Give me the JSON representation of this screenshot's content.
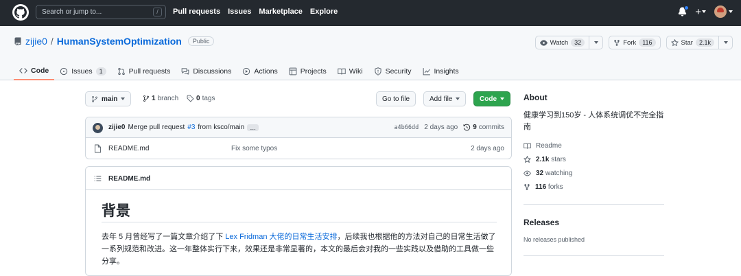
{
  "topnav": {
    "search_placeholder": "Search or jump to...",
    "search_shortcut": "/",
    "links": [
      "Pull requests",
      "Issues",
      "Marketplace",
      "Explore"
    ]
  },
  "repo": {
    "owner": "zijie0",
    "separator": "/",
    "name": "HumanSystemOptimization",
    "visibility": "Public",
    "watch_label": "Watch",
    "watch_count": "32",
    "fork_label": "Fork",
    "fork_count": "116",
    "star_label": "Star",
    "star_count": "2.1k"
  },
  "tabs": [
    {
      "label": "Code",
      "icon": "code-icon"
    },
    {
      "label": "Issues",
      "icon": "issue-icon",
      "count": "1"
    },
    {
      "label": "Pull requests",
      "icon": "pull-request-icon"
    },
    {
      "label": "Discussions",
      "icon": "discussion-icon"
    },
    {
      "label": "Actions",
      "icon": "play-icon"
    },
    {
      "label": "Projects",
      "icon": "table-icon"
    },
    {
      "label": "Wiki",
      "icon": "book-icon"
    },
    {
      "label": "Security",
      "icon": "shield-icon"
    },
    {
      "label": "Insights",
      "icon": "graph-icon"
    }
  ],
  "branchbar": {
    "branch": "main",
    "branch_count": "1",
    "branch_label": "branch",
    "tag_count": "0",
    "tag_label": "tags",
    "go_to_file": "Go to file",
    "add_file": "Add file",
    "code": "Code"
  },
  "commit": {
    "user": "zijie0",
    "message_prefix": "Merge pull request",
    "pr_ref": "#3",
    "message_suffix": "from ksco/main",
    "ellipsis": "…",
    "sha": "a4b66dd",
    "time": "2 days ago",
    "count": "9",
    "count_label": "commits"
  },
  "files": [
    {
      "name": "README.md",
      "message": "Fix some typos",
      "time": "2 days ago"
    }
  ],
  "readme": {
    "header": "README.md",
    "heading": "背景",
    "para_before": "去年 5 月曾经写了一篇文章介绍了下 ",
    "para_link": "Lex Fridman 大佬的日常生活安排",
    "para_after": "，后续我也根据他的方法对自己的日常生活做了一系列规范和改进。这一年整体实行下来，效果还是非常显著的，本文的最后会对我的一些实践以及借助的工具做一些分享。"
  },
  "about": {
    "title": "About",
    "description": "健康学习到150岁 - 人体系统调优不完全指南",
    "readme": "Readme",
    "stars_count": "2.1k",
    "stars_label": "stars",
    "watching_count": "32",
    "watching_label": "watching",
    "forks_count": "116",
    "forks_label": "forks"
  },
  "releases": {
    "title": "Releases",
    "none": "No releases published"
  },
  "colors": {
    "nav_bg": "#24292f",
    "link": "#0969da",
    "code_button": "#2da44e",
    "active_tab": "#fd8c73"
  }
}
